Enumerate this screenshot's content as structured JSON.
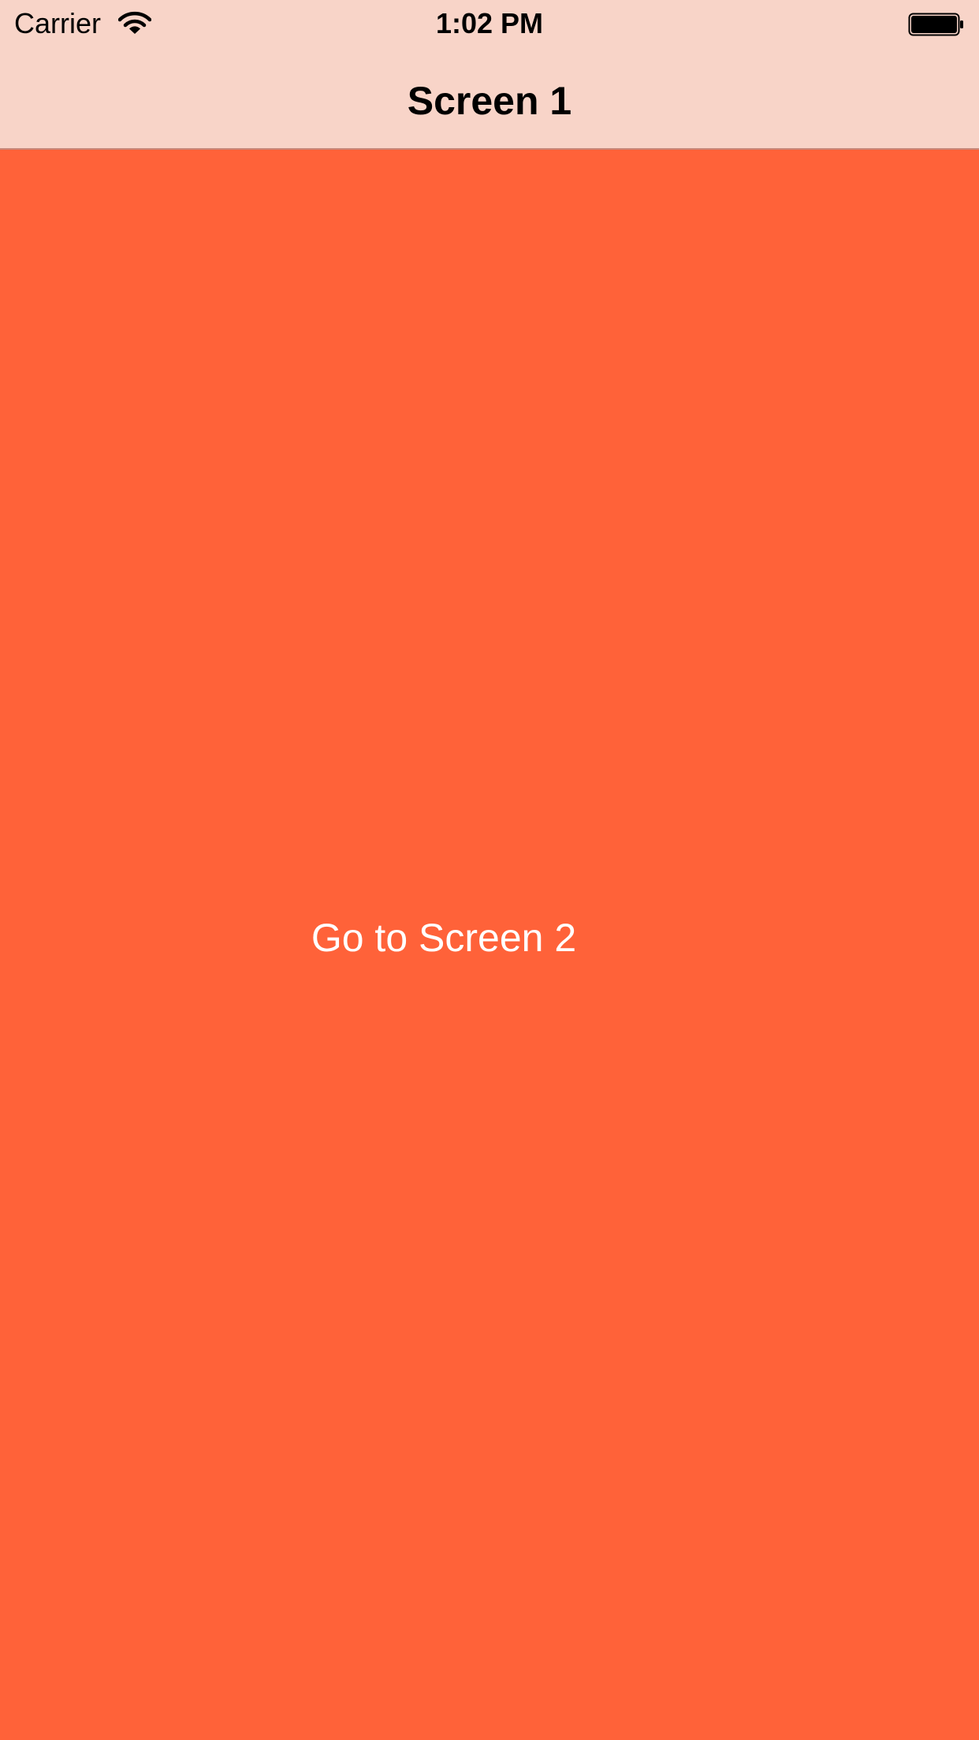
{
  "status_bar": {
    "carrier": "Carrier",
    "time": "1:02 PM",
    "wifi_icon": "wifi-icon",
    "battery_icon": "battery-icon",
    "battery_level": 1.0
  },
  "nav_bar": {
    "title": "Screen 1"
  },
  "main": {
    "button_label": "Go to Screen 2"
  },
  "colors": {
    "nav_background": "#F8D4C8",
    "content_background": "#FF6239",
    "button_text": "#FFFFFF"
  }
}
